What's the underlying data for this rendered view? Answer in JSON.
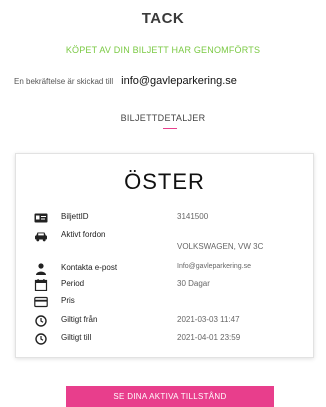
{
  "header": {
    "title": "TACK",
    "success_message": "KÖPET AV DIN BILJETT HAR GENOMFÖRTS",
    "confirmation_text": "En bekräftelse är skickad till",
    "confirmation_email": "info@gavleparkering.se"
  },
  "details": {
    "section_title": "BILJETTDETALJER",
    "zone": "ÖSTER",
    "rows": {
      "ticket_id": {
        "icon": "id-card-icon",
        "label": "BiljettID",
        "value": "3141500"
      },
      "vehicle": {
        "icon": "car-icon",
        "label": "Aktivt fordon",
        "value": "VOLKSWAGEN, VW 3C"
      },
      "email": {
        "icon": "person-icon",
        "label": "Kontakta e-post",
        "value": "Info@gavleparkering.se"
      },
      "period": {
        "icon": "calendar-icon",
        "label": "Period",
        "value": "30 Dagar"
      },
      "price": {
        "icon": "credit-card-icon",
        "label": "Pris",
        "value": ""
      },
      "valid_from": {
        "icon": "clock-icon",
        "label": "Giltigt från",
        "value": "2021-03-03 11:47"
      },
      "valid_to": {
        "icon": "clock-icon",
        "label": "Giltigt till",
        "value": "2021-04-01 23:59"
      }
    }
  },
  "actions": {
    "active_permits_button": "SE DINA AKTIVA TILLSTÅND"
  },
  "colors": {
    "accent": "#e83e8c",
    "success": "#7ac943"
  }
}
